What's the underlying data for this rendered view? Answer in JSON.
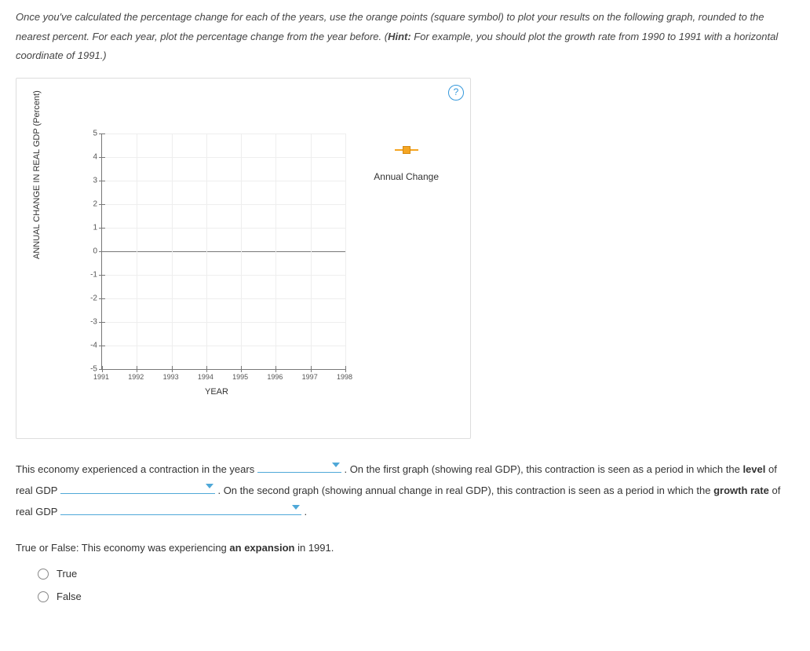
{
  "instructions": {
    "line1": "Once you've calculated the percentage change for each of the years, use the orange points (square symbol) to plot your results on the following graph, rounded to the nearest percent. For each year, plot the percentage change from the year before. (",
    "hint_label": "Hint:",
    "line2": " For example, you should plot the growth rate from 1990 to 1991 with a horizontal coordinate of 1991.)"
  },
  "chart_data": {
    "type": "scatter",
    "title": "",
    "xlabel": "YEAR",
    "ylabel": "ANNUAL CHANGE IN REAL GDP (Percent)",
    "x_ticks": [
      "1991",
      "1992",
      "1993",
      "1994",
      "1995",
      "1996",
      "1997",
      "1998"
    ],
    "y_ticks": [
      "5",
      "4",
      "3",
      "2",
      "1",
      "0",
      "-1",
      "-2",
      "-3",
      "-4",
      "-5"
    ],
    "ylim": [
      -5,
      5
    ],
    "xlim": [
      1991,
      1998
    ],
    "series": [
      {
        "name": "Annual Change",
        "values": []
      }
    ],
    "legend": {
      "label": "Annual Change"
    }
  },
  "help": {
    "symbol": "?"
  },
  "question": {
    "p1": "This economy experienced a contraction in the years ",
    "p2": " . On the first graph (showing real GDP), this contraction is seen as a period in which the ",
    "level_word": "level",
    "p3": " of real GDP ",
    "p4": " . On the second graph (showing annual change in real GDP), this contraction is seen as a period in which the ",
    "growth_word": "growth rate",
    "p5": " of real GDP ",
    "p6": " ."
  },
  "tf": {
    "prompt_a": "True or False: This economy was experiencing ",
    "prompt_bold": "an expansion",
    "prompt_b": " in 1991.",
    "opt_true": "True",
    "opt_false": "False"
  }
}
